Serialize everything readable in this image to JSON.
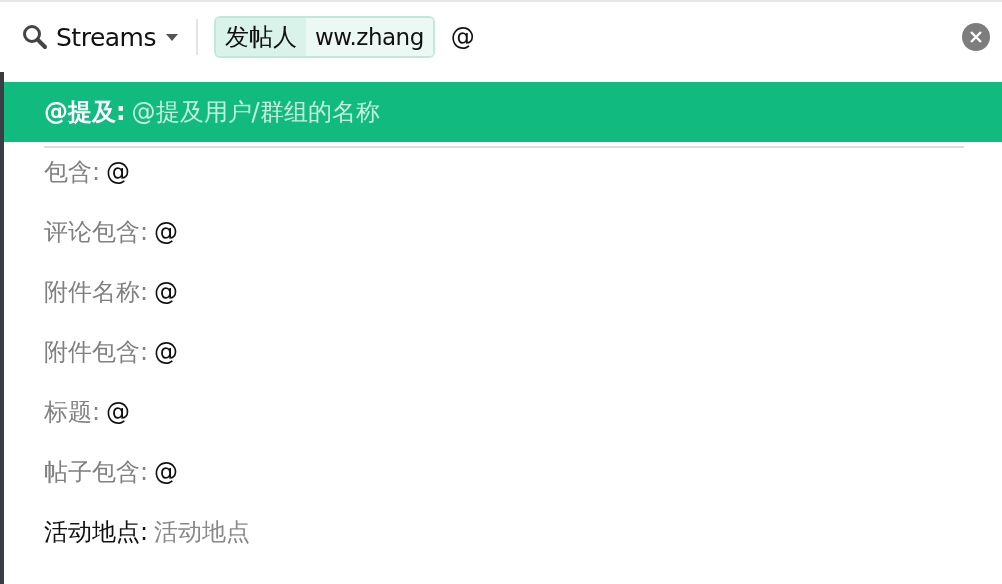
{
  "search_bar": {
    "scope": "Streams",
    "filter_chip": {
      "key": "发帖人",
      "value": "ww.zhang"
    },
    "query": "@"
  },
  "suggestions": [
    {
      "label": "@提及:",
      "value": "@提及用户/群组的名称",
      "kind": "hint",
      "selected": true
    },
    {
      "label": "包含:",
      "value": "@",
      "kind": "typed",
      "selected": false
    },
    {
      "label": "评论包含:",
      "value": "@",
      "kind": "typed",
      "selected": false
    },
    {
      "label": "附件名称:",
      "value": "@",
      "kind": "typed",
      "selected": false
    },
    {
      "label": "附件包含:",
      "value": "@",
      "kind": "typed",
      "selected": false
    },
    {
      "label": "标题:",
      "value": "@",
      "kind": "typed",
      "selected": false
    },
    {
      "label": "帖子包含:",
      "value": "@",
      "kind": "typed",
      "selected": false
    },
    {
      "label": "活动地点:",
      "value": "活动地点",
      "kind": "hint",
      "selected": false
    }
  ]
}
